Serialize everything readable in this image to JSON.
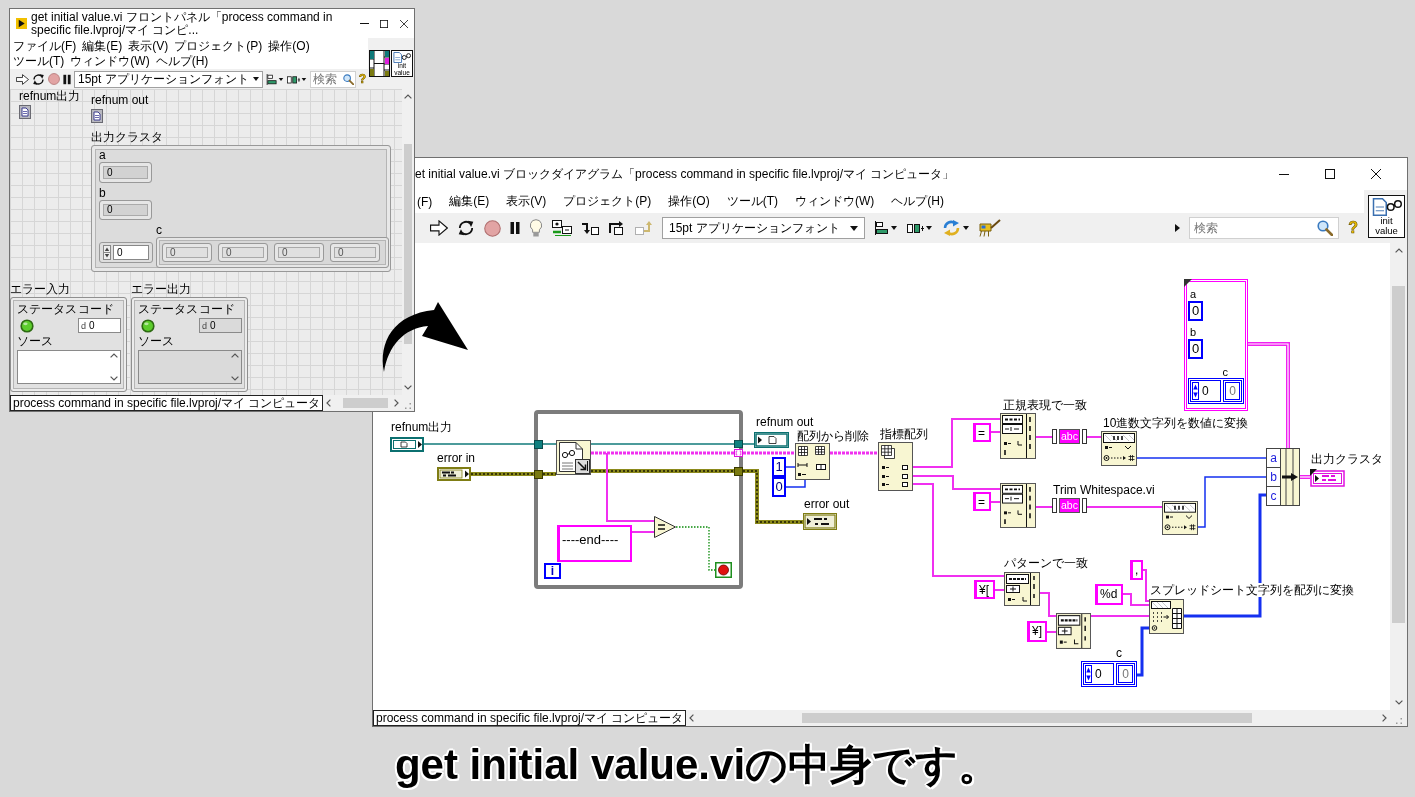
{
  "front_panel": {
    "title": "get initial value.vi フロントパネル「process command in specific file.lvproj/マイ コンピ...",
    "menu": [
      "ファイル(F)",
      "編集(E)",
      "表示(V)",
      "プロジェクト(P)",
      "操作(O)",
      "ツール(T)",
      "ウィンドウ(W)",
      "ヘルプ(H)"
    ],
    "toolbar": {
      "font": "15pt アプリケーションフォント",
      "search": {
        "placeholder": "検索"
      },
      "help": "?"
    },
    "vi_icon": [
      "init",
      "value"
    ],
    "refnums": [
      {
        "label": "refnum出力"
      },
      {
        "label": "refnum out"
      }
    ],
    "output_cluster": {
      "label": "出力クラスタ",
      "numerics": [
        {
          "label": "a",
          "value": "0"
        },
        {
          "label": "b",
          "value": "0"
        }
      ],
      "array": {
        "label": "c",
        "index": "0",
        "elements": [
          "0",
          "0",
          "0",
          "0"
        ]
      }
    },
    "error_clusters": [
      {
        "label": "エラー入力",
        "kind": "control",
        "status_label": "ステータス",
        "status": false,
        "code_label": "コード",
        "radix": "d",
        "code": "0",
        "source_label": "ソース"
      },
      {
        "label": "エラー出力",
        "kind": "indicator",
        "status_label": "ステータス",
        "status": false,
        "code_label": "コード",
        "radix": "d",
        "code": "0",
        "source_label": "ソース"
      }
    ],
    "status_bar": "process command in specific file.lvproj/マイ コンピュータ"
  },
  "block_diagram": {
    "title": "et initial value.vi ブロックダイアグラム「process command in specific file.lvproj/マイ コンピュータ」",
    "menu": [
      "(F)",
      "編集(E)",
      "表示(V)",
      "プロジェクト(P)",
      "操作(O)",
      "ツール(T)",
      "ウィンドウ(W)",
      "ヘルプ(H)"
    ],
    "toolbar": {
      "font": "15pt アプリケーションフォント",
      "search": {
        "placeholder": "検索"
      },
      "help": "?"
    },
    "vi_icon": [
      "init",
      "value"
    ],
    "terminals": [
      {
        "kind": "refnum-control",
        "label": "refnum出力"
      },
      {
        "kind": "error-control",
        "label": "error in"
      },
      {
        "kind": "refnum-indicator",
        "label": "refnum out"
      },
      {
        "kind": "error-indicator",
        "label": "error out"
      },
      {
        "kind": "cluster-indicator",
        "label": "出力クラスタ"
      }
    ],
    "while_loop": {
      "iteration": "i"
    },
    "functions": [
      {
        "kind": "read-file"
      },
      {
        "kind": "equal"
      },
      {
        "kind": "delete-from-array",
        "label": "配列から削除"
      },
      {
        "kind": "index-array",
        "label": "指標配列"
      },
      {
        "kind": "match-regex",
        "label": "正規表現で一致"
      },
      {
        "kind": "trim",
        "glyph": "abc"
      },
      {
        "kind": "decimal-to-number",
        "label": "10進数文字列を数値に変換"
      },
      {
        "kind": "match-regex"
      },
      {
        "kind": "trim",
        "glyph": "abc",
        "label": "Trim Whitespace.vi"
      },
      {
        "kind": "decimal-to-number"
      },
      {
        "kind": "match-pattern",
        "label": "パターンで一致"
      },
      {
        "kind": "match-pattern"
      },
      {
        "kind": "spreadsheet-to-array",
        "label": "スプレッドシート文字列を配列に変換"
      },
      {
        "kind": "bundle-by-name",
        "items": [
          "a",
          "b",
          "c"
        ]
      }
    ],
    "constants": [
      {
        "kind": "string",
        "value": "----end----"
      },
      {
        "kind": "numeric",
        "value": "1"
      },
      {
        "kind": "numeric",
        "value": "0"
      },
      {
        "kind": "string",
        "value": "="
      },
      {
        "kind": "string",
        "value": "="
      },
      {
        "kind": "string",
        "value": "¥["
      },
      {
        "kind": "string",
        "value": "¥]"
      },
      {
        "kind": "string",
        "value": ","
      },
      {
        "kind": "string",
        "value": "%d"
      }
    ],
    "cluster_constant": {
      "elements": [
        {
          "label": "a",
          "value": "0"
        },
        {
          "label": "b",
          "value": "0"
        }
      ],
      "array": {
        "label": "c",
        "index": "0",
        "element": "0"
      }
    },
    "array_constant": {
      "label": "c",
      "index": "0",
      "element": "0"
    },
    "status_bar": "process command in specific file.lvproj/マイ コンピュータ"
  },
  "caption": "get initial value.viの中身です。"
}
